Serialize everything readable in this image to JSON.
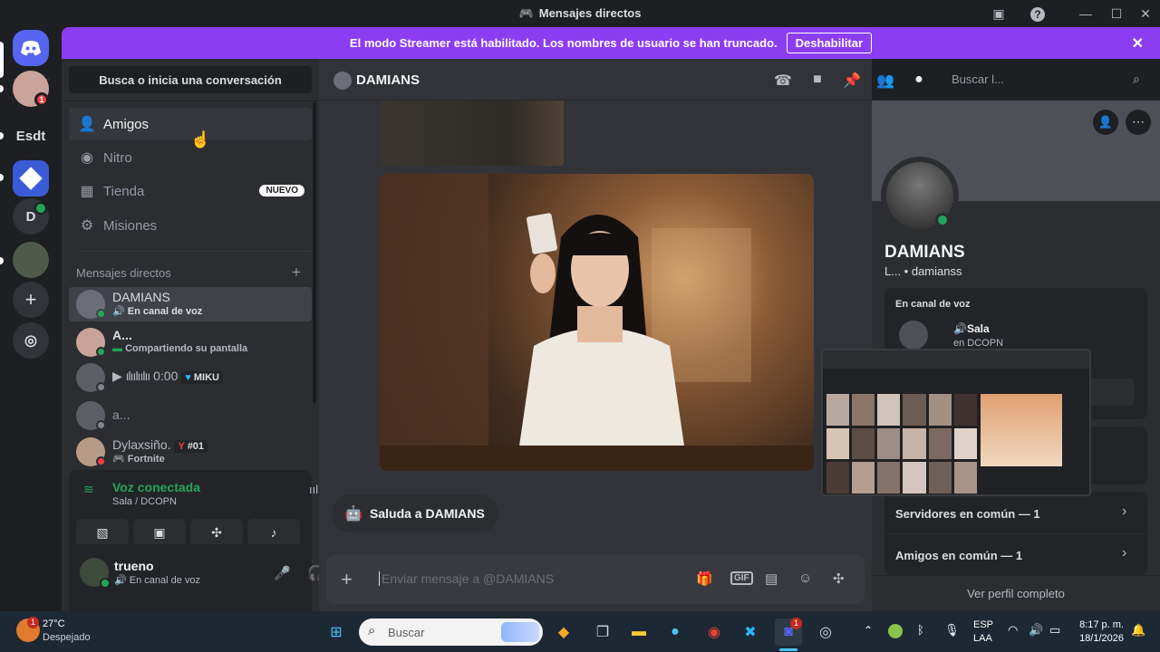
{
  "window": {
    "title": "Mensajes directos"
  },
  "banner": {
    "text": "El modo Streamer está habilitado. Los nombres de usuario se han truncado.",
    "button": "Deshabilitar"
  },
  "rail": {
    "esdt": "Esdt",
    "d": "D",
    "badge": "1"
  },
  "sidebar": {
    "search": "Busca o inicia una conversación",
    "nav": [
      {
        "label": "Amigos"
      },
      {
        "label": "Nitro"
      },
      {
        "label": "Tienda",
        "badge": "NUEVO"
      },
      {
        "label": "Misiones"
      }
    ],
    "dm_header": "Mensajes directos",
    "dms": [
      {
        "name": "DAMIANS",
        "sub": "En canal de voz"
      },
      {
        "name": "A...",
        "sub": "Compartiendo su pantalla"
      },
      {
        "name": "",
        "sub": "0:00",
        "tag": "MIKU"
      },
      {
        "name": "a...",
        "sub": ""
      },
      {
        "name": "Dylaxsiño.",
        "sub": "Fortnite",
        "tag": "#01"
      }
    ]
  },
  "voice": {
    "status": "Voz conectada",
    "channel": "Sala / DCOPN"
  },
  "user": {
    "name": "trueno",
    "status": "En canal de voz"
  },
  "chat": {
    "title": "DAMIANS",
    "search_placeholder": "Buscar l...",
    "wave": "Saluda a DAMIANS",
    "composer_placeholder": "Enviar mensaje a @DAMIANS"
  },
  "profile": {
    "name": "DAMIANS",
    "username": "L... • damianss",
    "voice_header": "En canal de voz",
    "voice_channel": "Sala",
    "voice_server": "en DCOPN",
    "servers_common": "Servidores en común — 1",
    "friends_common": "Amigos en común — 1",
    "view_full": "Ver perfil completo"
  },
  "taskbar": {
    "weather_temp": "27°C",
    "weather_desc": "Despejado",
    "weather_badge": "1",
    "search": "Buscar",
    "lang1": "ESP",
    "lang2": "LAA",
    "time": "8:17 p. m.",
    "date": "18/1/2026",
    "discord_badge": "1"
  },
  "colors": {
    "accent": "#5865f2",
    "banner": "#8c3df1",
    "online": "#23a55a",
    "danger": "#f23f43"
  }
}
